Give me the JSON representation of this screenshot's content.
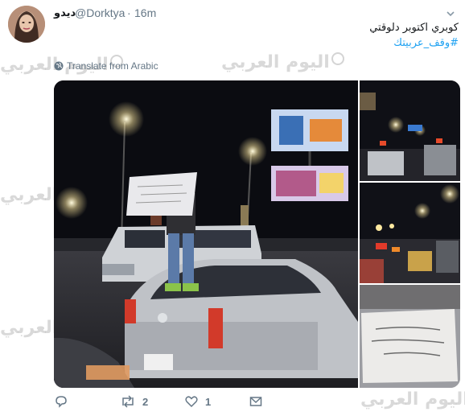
{
  "tweet": {
    "author_name": "ديدو",
    "handle": "@Dorktya",
    "separator": "·",
    "time": "16m",
    "text": "كوبري اكتوبر دلوقتي",
    "hashtag": "#وقف_عربيتك",
    "translate_label": "Translate from Arabic"
  },
  "actions": {
    "reply_count": "",
    "retweet_count": "2",
    "like_count": "1"
  },
  "watermark": {
    "text": "اليوم العربي"
  },
  "colors": {
    "link": "#1da1f2",
    "muted": "#657786",
    "text": "#14171a"
  },
  "icons": [
    "chevron-down-icon",
    "globe-icon",
    "reply-icon",
    "retweet-icon",
    "heart-icon",
    "envelope-icon"
  ]
}
